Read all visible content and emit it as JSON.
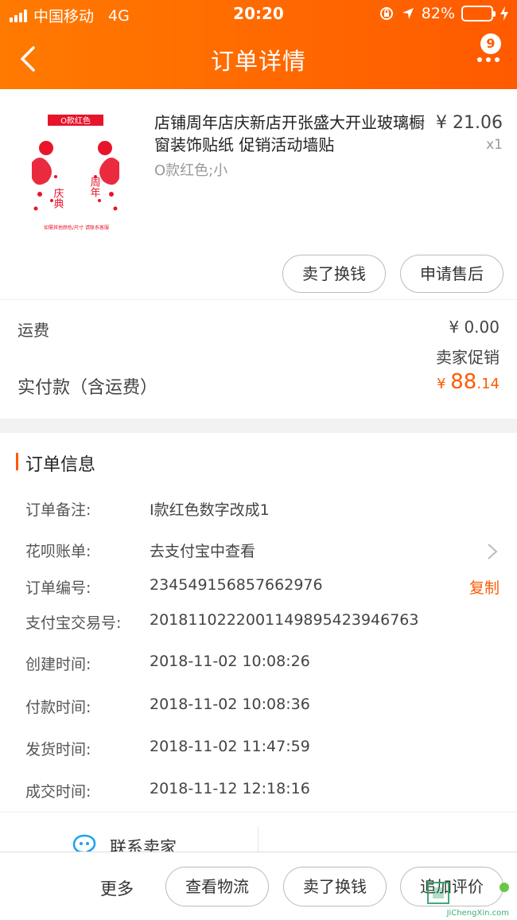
{
  "status_bar": {
    "carrier": "中国移动",
    "network": "4G",
    "time": "20:20",
    "battery": "82%",
    "battery_level": 0.82
  },
  "nav": {
    "title": "订单详情",
    "badge_count": "9"
  },
  "product": {
    "image_label": "O款红色",
    "image_text_left": "庆典",
    "image_text_right": "周年",
    "image_footer": "如需其他颜色/尺寸 请联系客服",
    "title": "店铺周年店庆新店开张盛大开业玻璃橱窗装饰贴纸 促销活动墙贴",
    "sku": "O款红色;小",
    "price": "¥ 21.06",
    "qty": "x1"
  },
  "product_actions": {
    "sell_label": "卖了换钱",
    "after_sale_label": "申请售后"
  },
  "fees": {
    "shipping_label": "运费",
    "shipping_value": "¥ 0.00",
    "promo_label": "卖家促销",
    "total_label": "实付款（含运费）",
    "total_yen": "¥ ",
    "total_int": "88",
    "total_dec": ".14"
  },
  "order_info": {
    "title": "订单信息",
    "rows": [
      {
        "key": "订单备注:",
        "value": "I款红色数字改成1"
      },
      {
        "key": "花呗账单:",
        "value": "去支付宝中查看"
      },
      {
        "key": "订单编号:",
        "value": "234549156857662976"
      },
      {
        "key": "支付宝交易号:",
        "value": "2018110222001149895423946763"
      },
      {
        "key": "创建时间:",
        "value": "2018-11-02 10:08:26"
      },
      {
        "key": "付款时间:",
        "value": "2018-11-02 10:08:36"
      },
      {
        "key": "发货时间:",
        "value": "2018-11-02 11:47:59"
      },
      {
        "key": "成交时间:",
        "value": "2018-11-12 12:18:16"
      }
    ],
    "copy_label": "复制"
  },
  "contact": {
    "label": "联系卖家"
  },
  "bottom_bar": {
    "more_label": "更多",
    "logistics_label": "查看物流",
    "sell_label": "卖了换钱",
    "review_label": "追加评价"
  },
  "watermark": {
    "text": "JiChengXin.com"
  },
  "colors": {
    "accent": "#ff5a00",
    "header_start": "#ff7a00"
  }
}
